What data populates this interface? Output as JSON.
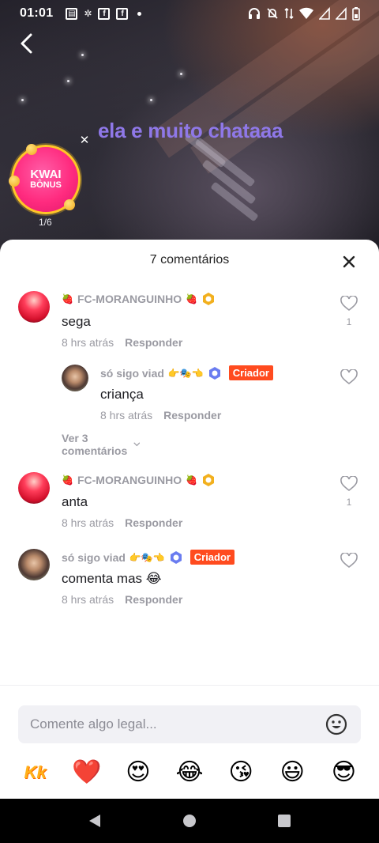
{
  "status_bar": {
    "time": "01:01",
    "icons_left": [
      "news-icon",
      "sim-icon",
      "facebook-icon",
      "facebook-icon",
      "dot-icon"
    ],
    "icons_right": [
      "headset-icon",
      "mute-icon",
      "data-icon",
      "wifi-icon",
      "signal-icon",
      "signal-icon",
      "battery-icon"
    ]
  },
  "video": {
    "caption": "ela e muito chataaa"
  },
  "bonus": {
    "line1": "KWAI",
    "line2": "BÔNUS",
    "progress": "1/6"
  },
  "sheet": {
    "title": "7 comentários"
  },
  "comments": [
    {
      "username": "FC-MORANGUINHO",
      "prefix_emoji": "🍓",
      "suffix_emoji": "🍓",
      "text": "sega",
      "time": "8 hrs atrás",
      "reply": "Responder",
      "likes": "1",
      "replies": [
        {
          "username": "só sigo viad",
          "emojis": "👉🎭👈",
          "badge": "Criador",
          "text": "criança",
          "time": "8 hrs atrás",
          "reply": "Responder"
        }
      ],
      "view_more": "Ver 3 comentários"
    },
    {
      "username": "FC-MORANGUINHO",
      "prefix_emoji": "🍓",
      "suffix_emoji": "🍓",
      "text": "anta",
      "time": "8 hrs atrás",
      "reply": "Responder",
      "likes": "1"
    },
    {
      "username": "só sigo viad",
      "emojis": "👉🎭👈",
      "badge": "Criador",
      "text": "comenta mas 😂",
      "time": "8 hrs atrás",
      "reply": "Responder"
    }
  ],
  "input": {
    "placeholder": "Comente algo legal..."
  },
  "quick_emojis": [
    "❤️",
    "😍",
    "😂",
    "😘",
    "😃",
    "😎"
  ],
  "colors": {
    "caption": "#8f78e8",
    "creator_badge": "#ff4b1f",
    "bonus_pink": "#ff2b7f",
    "bonus_ring": "#ffc627",
    "verified_gold": "#f2b01e",
    "verified_blue": "#6a7cf0"
  }
}
